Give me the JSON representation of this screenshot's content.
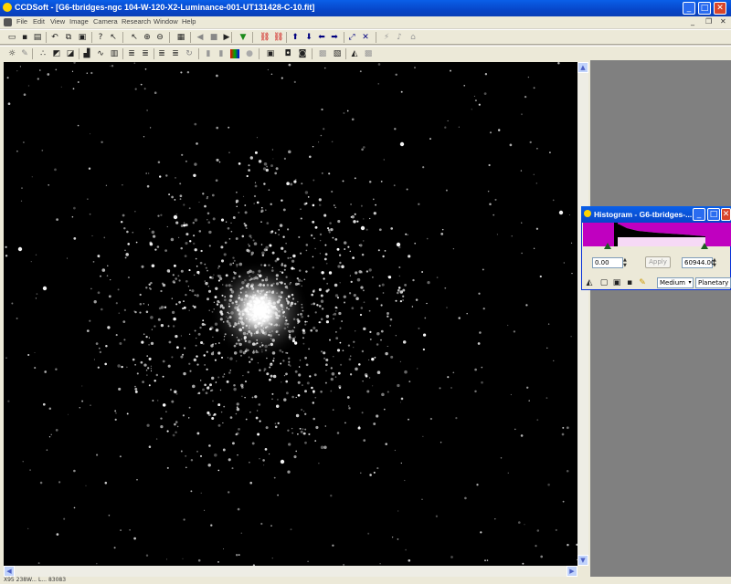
{
  "window": {
    "title": "CCDSoft - [G6-tbridges-ngc 104-W-120-X2-Luminance-001-UT131428-C-10.fit]",
    "minimize": "_",
    "maximize": "□",
    "close": "✕"
  },
  "menu": [
    "File",
    "Edit",
    "View",
    "Image",
    "Camera",
    "Research",
    "Window",
    "Help"
  ],
  "image": {
    "subject": "NGC 104 globular cluster (Luminance)"
  },
  "status": {
    "text": "X95 238W... L...  83083"
  },
  "histogram": {
    "title": "Histogram - G6-tbridges-...",
    "min_value": "0.00",
    "max_value": "60944.00",
    "apply_label": "Apply",
    "contrast_option": "Medium",
    "mode_option": "Planetary",
    "colors": {
      "plot_bg": "#c000c0",
      "curve": "#000000"
    }
  }
}
